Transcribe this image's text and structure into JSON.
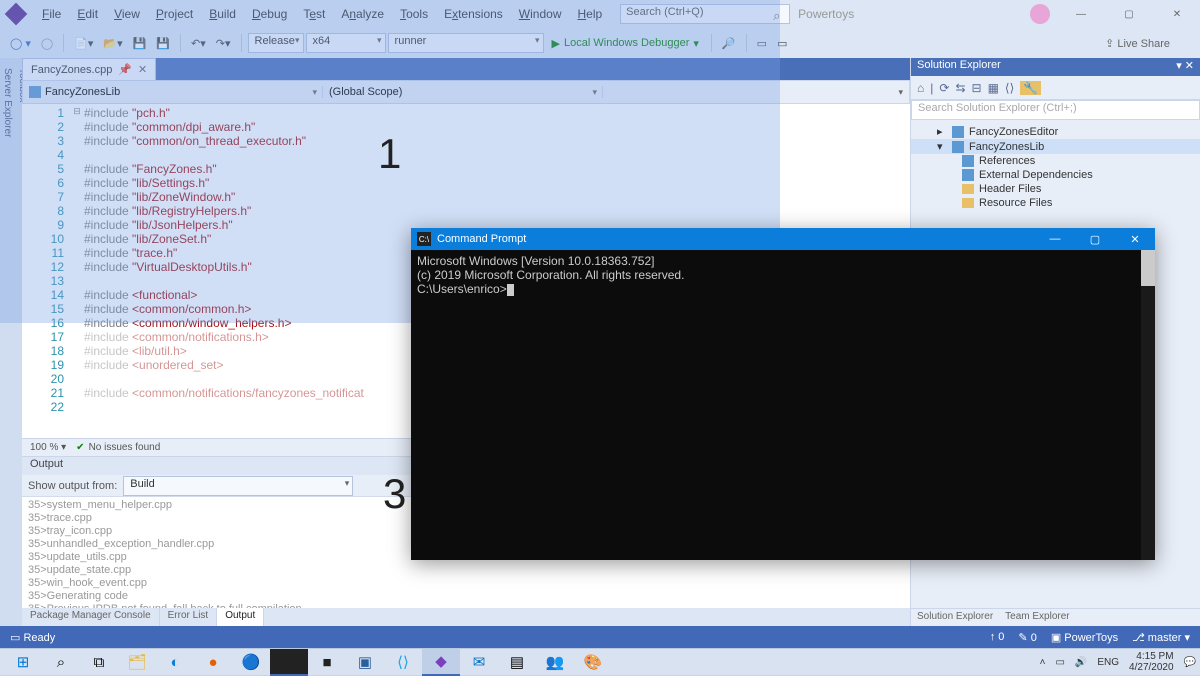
{
  "menu": {
    "items": [
      "File",
      "Edit",
      "View",
      "Project",
      "Build",
      "Debug",
      "Test",
      "Analyze",
      "Tools",
      "Extensions",
      "Window",
      "Help"
    ],
    "search_placeholder": "Search (Ctrl+Q)",
    "powertoys": "Powertoys"
  },
  "toolbar": {
    "config": "Release",
    "platform": "x64",
    "project": "runner",
    "debugger": "Local Windows Debugger",
    "live_share": "Live Share"
  },
  "tabs": {
    "file": "FancyZones.cpp"
  },
  "nav": {
    "scope1": "FancyZonesLib",
    "scope2": "(Global Scope)"
  },
  "code_lines": [
    {
      "n": 1,
      "t": "#include \"pch.h\"",
      "type": "inc-str"
    },
    {
      "n": 2,
      "t": "#include \"common/dpi_aware.h\"",
      "type": "inc-str"
    },
    {
      "n": 3,
      "t": "#include \"common/on_thread_executor.h\"",
      "type": "inc-str"
    },
    {
      "n": 4,
      "t": "",
      "type": "blank"
    },
    {
      "n": 5,
      "t": "#include \"FancyZones.h\"",
      "type": "inc-str"
    },
    {
      "n": 6,
      "t": "#include \"lib/Settings.h\"",
      "type": "inc-str"
    },
    {
      "n": 7,
      "t": "#include \"lib/ZoneWindow.h\"",
      "type": "inc-str"
    },
    {
      "n": 8,
      "t": "#include \"lib/RegistryHelpers.h\"",
      "type": "inc-str"
    },
    {
      "n": 9,
      "t": "#include \"lib/JsonHelpers.h\"",
      "type": "inc-str"
    },
    {
      "n": 10,
      "t": "#include \"lib/ZoneSet.h\"",
      "type": "inc-str"
    },
    {
      "n": 11,
      "t": "#include \"trace.h\"",
      "type": "inc-str"
    },
    {
      "n": 12,
      "t": "#include \"VirtualDesktopUtils.h\"",
      "type": "inc-str"
    },
    {
      "n": 13,
      "t": "",
      "type": "blank"
    },
    {
      "n": 14,
      "t": "#include <functional>",
      "type": "inc-ang"
    },
    {
      "n": 15,
      "t": "#include <common/common.h>",
      "type": "inc-ang"
    },
    {
      "n": 16,
      "t": "#include <common/window_helpers.h>",
      "type": "inc-ang"
    },
    {
      "n": 17,
      "t": "#include <common/notifications.h>",
      "type": "inc-ang",
      "faded": true
    },
    {
      "n": 18,
      "t": "#include <lib/util.h>",
      "type": "inc-ang",
      "faded": true
    },
    {
      "n": 19,
      "t": "#include <unordered_set>",
      "type": "inc-ang",
      "faded": true
    },
    {
      "n": 20,
      "t": "",
      "type": "blank",
      "faded": true
    },
    {
      "n": 21,
      "t": "#include <common/notifications/fancyzones_notificat",
      "type": "inc-ang",
      "faded": true
    },
    {
      "n": 22,
      "t": "",
      "type": "blank",
      "faded": true
    }
  ],
  "editor_status": {
    "zoom": "100 %",
    "issues": "No issues found"
  },
  "output": {
    "title": "Output",
    "from_label": "Show output from:",
    "from_value": "Build",
    "lines": [
      "35>system_menu_helper.cpp",
      "35>trace.cpp",
      "35>tray_icon.cpp",
      "35>unhandled_exception_handler.cpp",
      "35>update_utils.cpp",
      "35>update_state.cpp",
      "35>win_hook_event.cpp",
      "35>Generating code",
      "35>Previous IPDB not found, fall back to full compilation."
    ]
  },
  "bottom_tabs": [
    "Package Manager Console",
    "Error List",
    "Output"
  ],
  "solution_explorer": {
    "title": "Solution Explorer",
    "search_placeholder": "Search Solution Explorer (Ctrl+;)",
    "tree": [
      {
        "lvl": 0,
        "icon": "proj",
        "label": "FancyZonesEditor"
      },
      {
        "lvl": 0,
        "icon": "proj",
        "label": "FancyZonesLib",
        "sel": true
      },
      {
        "lvl": 1,
        "icon": "ref",
        "label": "References"
      },
      {
        "lvl": 1,
        "icon": "ref",
        "label": "External Dependencies"
      },
      {
        "lvl": 1,
        "icon": "folder",
        "label": "Header Files"
      },
      {
        "lvl": 1,
        "icon": "folder",
        "label": "Resource Files"
      }
    ],
    "bottom_tabs": [
      "Solution Explorer",
      "Team Explorer"
    ]
  },
  "status_bar": {
    "ready": "Ready",
    "repo": "PowerToys",
    "branch": "master",
    "up": "0",
    "down": "0"
  },
  "cmd": {
    "title": "Command Prompt",
    "lines": [
      "Microsoft Windows [Version 10.0.18363.752]",
      "(c) 2019 Microsoft Corporation. All rights reserved.",
      "",
      "C:\\Users\\enrico>"
    ]
  },
  "taskbar": {
    "lang": "ENG",
    "time": "4:15 PM",
    "date": "4/27/2020"
  },
  "zones": {
    "z1": "1",
    "z3": "3"
  }
}
